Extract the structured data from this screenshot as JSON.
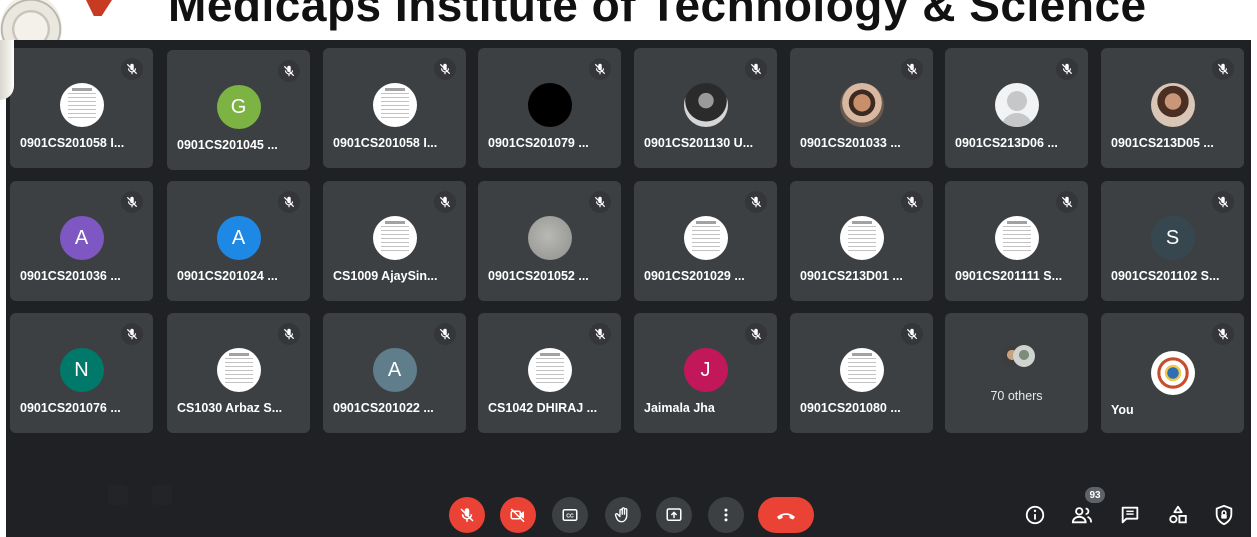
{
  "slide": {
    "title": "Medicaps Institute of Technology & Science"
  },
  "tiles": [
    {
      "name": "0901CS201058 I...",
      "avatar": "doc"
    },
    {
      "name": "0901CS201045 ...",
      "avatar": "letter",
      "letter": "G",
      "color": "#7cb342"
    },
    {
      "name": "0901CS201058 I...",
      "avatar": "doc"
    },
    {
      "name": "0901CS201079 ...",
      "avatar": "black"
    },
    {
      "name": "0901CS201130 U...",
      "avatar": "photo-dark"
    },
    {
      "name": "0901CS201033 ...",
      "avatar": "photo-face"
    },
    {
      "name": "0901CS213D06 ...",
      "avatar": "person"
    },
    {
      "name": "0901CS213D05 ...",
      "avatar": "photo-girl"
    },
    {
      "name": "0901CS201036 ...",
      "avatar": "letter",
      "letter": "A",
      "color": "#7e57c2"
    },
    {
      "name": "0901CS201024 ...",
      "avatar": "letter",
      "letter": "A",
      "color": "#1e88e5"
    },
    {
      "name": "CS1009 AjaySin...",
      "avatar": "doc"
    },
    {
      "name": "0901CS201052 ...",
      "avatar": "gray"
    },
    {
      "name": "0901CS201029 ...",
      "avatar": "doc"
    },
    {
      "name": "0901CS213D01 ...",
      "avatar": "doc"
    },
    {
      "name": "0901CS201111 S...",
      "avatar": "doc"
    },
    {
      "name": "0901CS201102 S...",
      "avatar": "letter",
      "letter": "S",
      "color": "#37474f"
    },
    {
      "name": "0901CS201076 ...",
      "avatar": "letter",
      "letter": "N",
      "color": "#00796b"
    },
    {
      "name": "CS1030 Arbaz S...",
      "avatar": "doc"
    },
    {
      "name": "0901CS201022 ...",
      "avatar": "letter",
      "letter": "A",
      "color": "#607d8b"
    },
    {
      "name": "CS1042 DHIRAJ ...",
      "avatar": "doc"
    },
    {
      "name": "Jaimala Jha",
      "avatar": "letter",
      "letter": "J",
      "color": "#c2185b"
    },
    {
      "name": "0901CS201080 ...",
      "avatar": "doc"
    }
  ],
  "others": {
    "label": "70 others"
  },
  "self": {
    "name": "You"
  },
  "toolbar": {
    "controls": [
      "mic-off",
      "camera-off",
      "captions",
      "raise-hand",
      "present",
      "more-options",
      "end-call"
    ]
  },
  "tray": {
    "people_count": "93",
    "icons": [
      "info",
      "people",
      "chat",
      "activities",
      "host-controls"
    ]
  },
  "colors": {
    "background": "#202124",
    "tile": "#3c4043",
    "danger": "#ea4335"
  }
}
